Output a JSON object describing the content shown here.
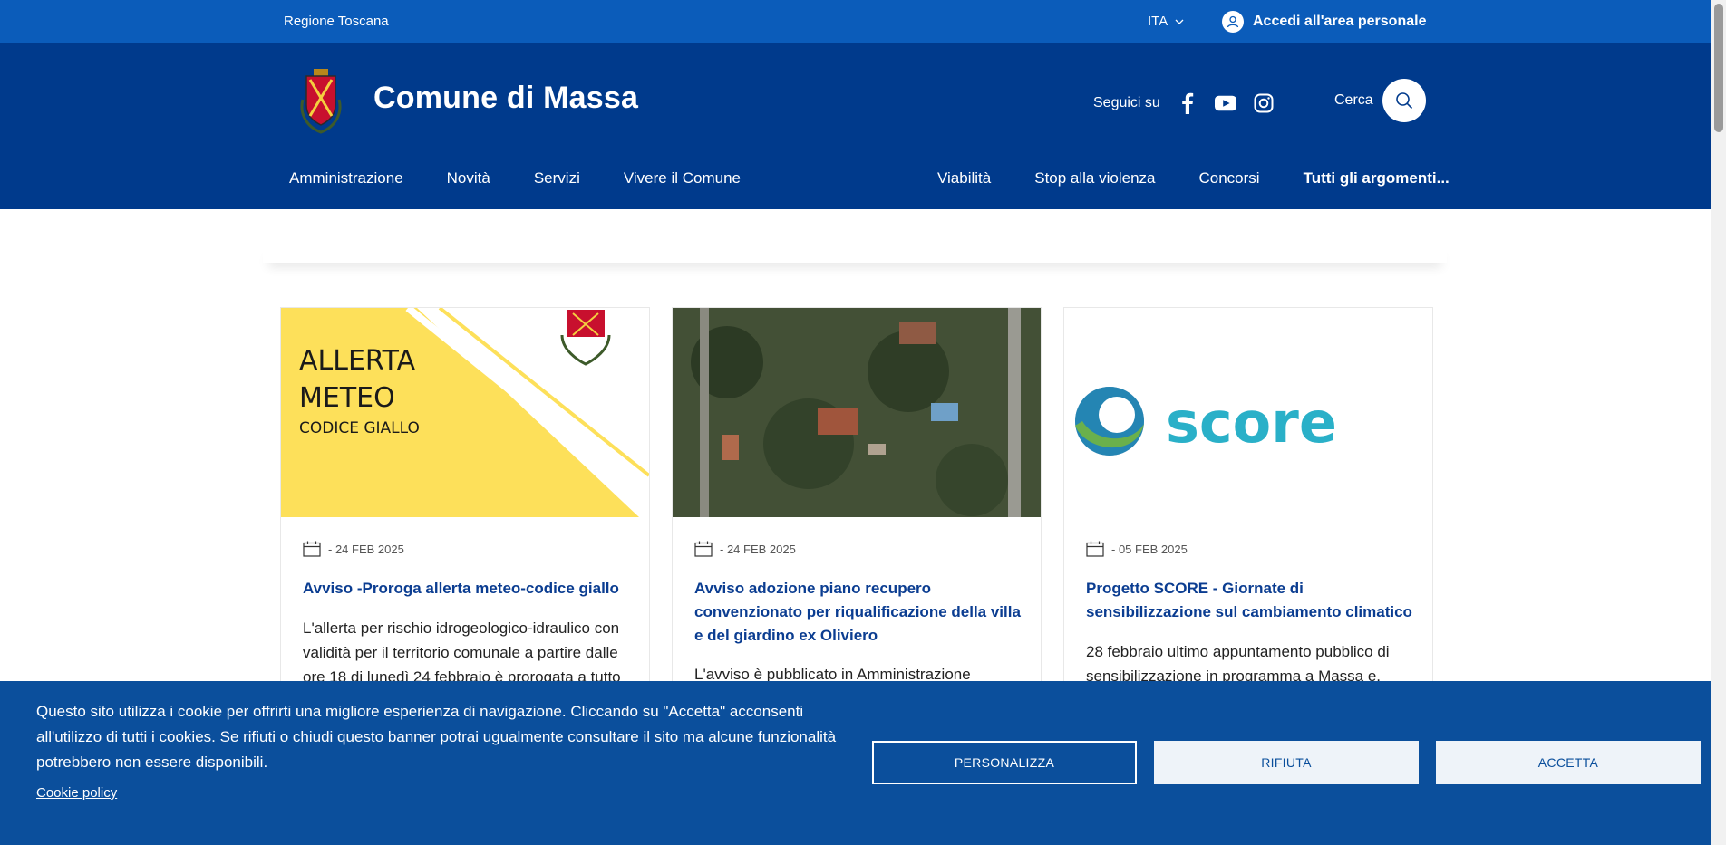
{
  "topbar": {
    "region": "Regione Toscana",
    "language": "ITA",
    "login": "Accedi all'area personale"
  },
  "header": {
    "title": "Comune di Massa",
    "follow_label": "Seguici su",
    "search_label": "Cerca"
  },
  "nav": {
    "left": [
      "Amministrazione",
      "Novità",
      "Servizi",
      "Vivere il Comune"
    ],
    "right": [
      "Viabilità",
      "Stop alla violenza",
      "Concorsi",
      "Tutti gli argomenti..."
    ]
  },
  "cards": [
    {
      "image_text": [
        "ALLERTA",
        "METEO",
        "CODICE GIALLO"
      ],
      "date": "- 24 FEB 2025",
      "title": "Avviso -Proroga allerta meteo-codice giallo",
      "text": "L'allerta per rischio idrogeologico-idraulico con validità per il territorio comunale a partire dalle ore 18 di lunedì 24 febbraio è prorogata a tutto"
    },
    {
      "date": "- 24 FEB 2025",
      "title": "Avviso adozione piano recupero convenzionato per riqualificazione della villa e del giardino ex Oliviero",
      "text": "L'avviso è pubblicato in Amministrazione"
    },
    {
      "image_text": "score",
      "date": "- 05 FEB 2025",
      "title": "Progetto SCORE - Giornate di sensibilizzazione sul cambiamento climatico",
      "text": "28 febbraio ultimo appuntamento pubblico di sensibilizzazione in programma a Massa e."
    }
  ],
  "cookie": {
    "text": "Questo sito utilizza i cookie per offrirti una migliore esperienza di navigazione. Cliccando su \"Accetta\" acconsenti all'utilizzo di tutti i cookies. Se rifiuti o chiudi questo banner potrai ugualmente consultare il sito ma alcune funzionalità potrebbero non essere disponibili.",
    "policy_link": "Cookie policy",
    "buttons": {
      "personalizza": "PERSONALIZZA",
      "rifiuta": "RIFIUTA",
      "accetta": "ACCETTA"
    }
  },
  "colors": {
    "topbar": "#0b5cba",
    "header": "#003a8c",
    "cookie_banner": "#0b4f9c",
    "card_title": "#0b3d91"
  }
}
